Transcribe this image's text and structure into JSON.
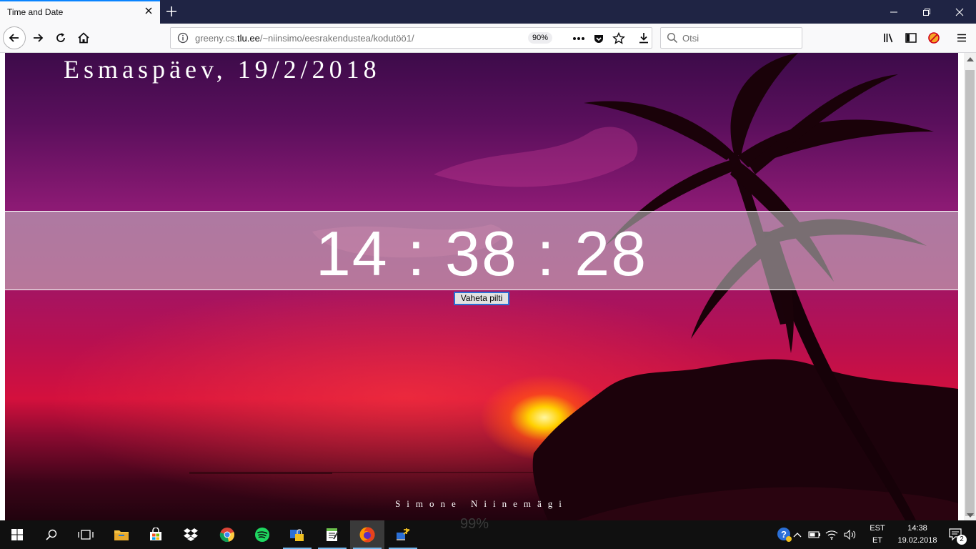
{
  "browser": {
    "tab_title": "Time and Date",
    "url_prefix": "greeny.cs.",
    "url_host": "tlu.ee",
    "url_path": "/~niinsimo/eesrakendustea/kodutöö1/",
    "zoom": "90%",
    "search_placeholder": "Otsi"
  },
  "page": {
    "date": "Esmaspäev, 19/2/2018",
    "time": "14 : 38 : 28",
    "button_label": "Vaheta pilti",
    "author": "Simone Niinemägi"
  },
  "taskbar": {
    "ghost_text": "99%",
    "language_top": "EST",
    "language_bottom": "ET",
    "clock_time": "14:38",
    "clock_date": "19.02.2018",
    "notification_count": "2"
  },
  "colors": {
    "titlebar": "#1f2444",
    "accent": "#0a84ff",
    "taskbar": "#101010"
  }
}
